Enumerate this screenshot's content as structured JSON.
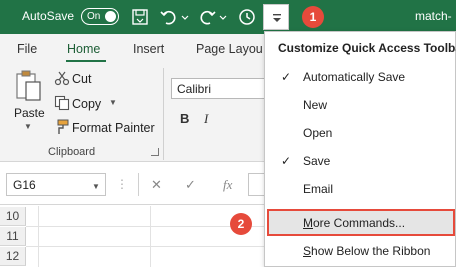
{
  "titlebar": {
    "autosave_label": "AutoSave",
    "toggle_label": "On",
    "title": "match-"
  },
  "badges": [
    "1",
    "2"
  ],
  "tabs": {
    "file": "File",
    "home": "Home",
    "insert": "Insert",
    "page_layout": "Page Layou"
  },
  "ribbon": {
    "paste": "Paste",
    "cut": "Cut",
    "copy": "Copy",
    "format_painter": "Format Painter",
    "clipboard_group": "Clipboard",
    "font_name": "Calibri",
    "bold": "B",
    "italic": "I"
  },
  "formula_bar": {
    "name_box": "G16",
    "fx": "fx"
  },
  "grid": {
    "rows": [
      "10",
      "11",
      "12"
    ]
  },
  "menu": {
    "title": "Customize Quick Access Toolbar",
    "items": [
      {
        "label": "Automatically Save",
        "checked": true
      },
      {
        "label": "New",
        "checked": false
      },
      {
        "label": "Open",
        "checked": false
      },
      {
        "label": "Save",
        "checked": true
      },
      {
        "label": "Email",
        "checked": false
      },
      {
        "label": "More Commands...",
        "checked": false,
        "highlighted": true
      },
      {
        "label": "Show Below the Ribbon",
        "checked": false
      }
    ]
  },
  "colors": {
    "excel_green": "#217346",
    "badge_red": "#e64a3b",
    "highlight_gray": "#e5e5e5"
  }
}
